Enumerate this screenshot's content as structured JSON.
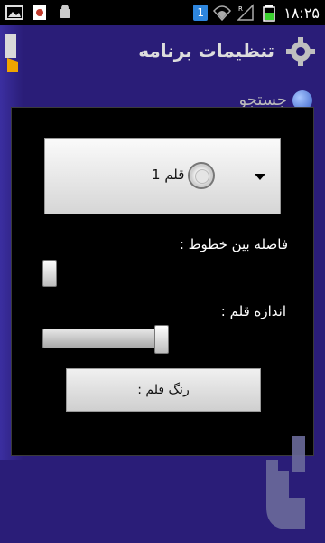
{
  "status_bar": {
    "left_icons": [
      "image-icon",
      "app-notification-icon",
      "android-icon"
    ],
    "sim_badge": "1",
    "time": "۱۸:۲۵"
  },
  "header": {
    "title": "تنظیمات برنامه",
    "icon": "gear-icon"
  },
  "background": {
    "partial_text": "جستجو"
  },
  "dialog": {
    "pen_spinner_label": "قلم 1",
    "line_spacing_label": "فاصله بین خطوط :",
    "pen_size_label": "اندازه قلم :",
    "pen_size_value_fraction": 1.0,
    "line_spacing_value_fraction": 0.0,
    "pen_color_button": "رنگ قلم :"
  },
  "colors": {
    "background": "#2a1d78",
    "dialog_bg": "#000000",
    "text": "#ffffff"
  }
}
